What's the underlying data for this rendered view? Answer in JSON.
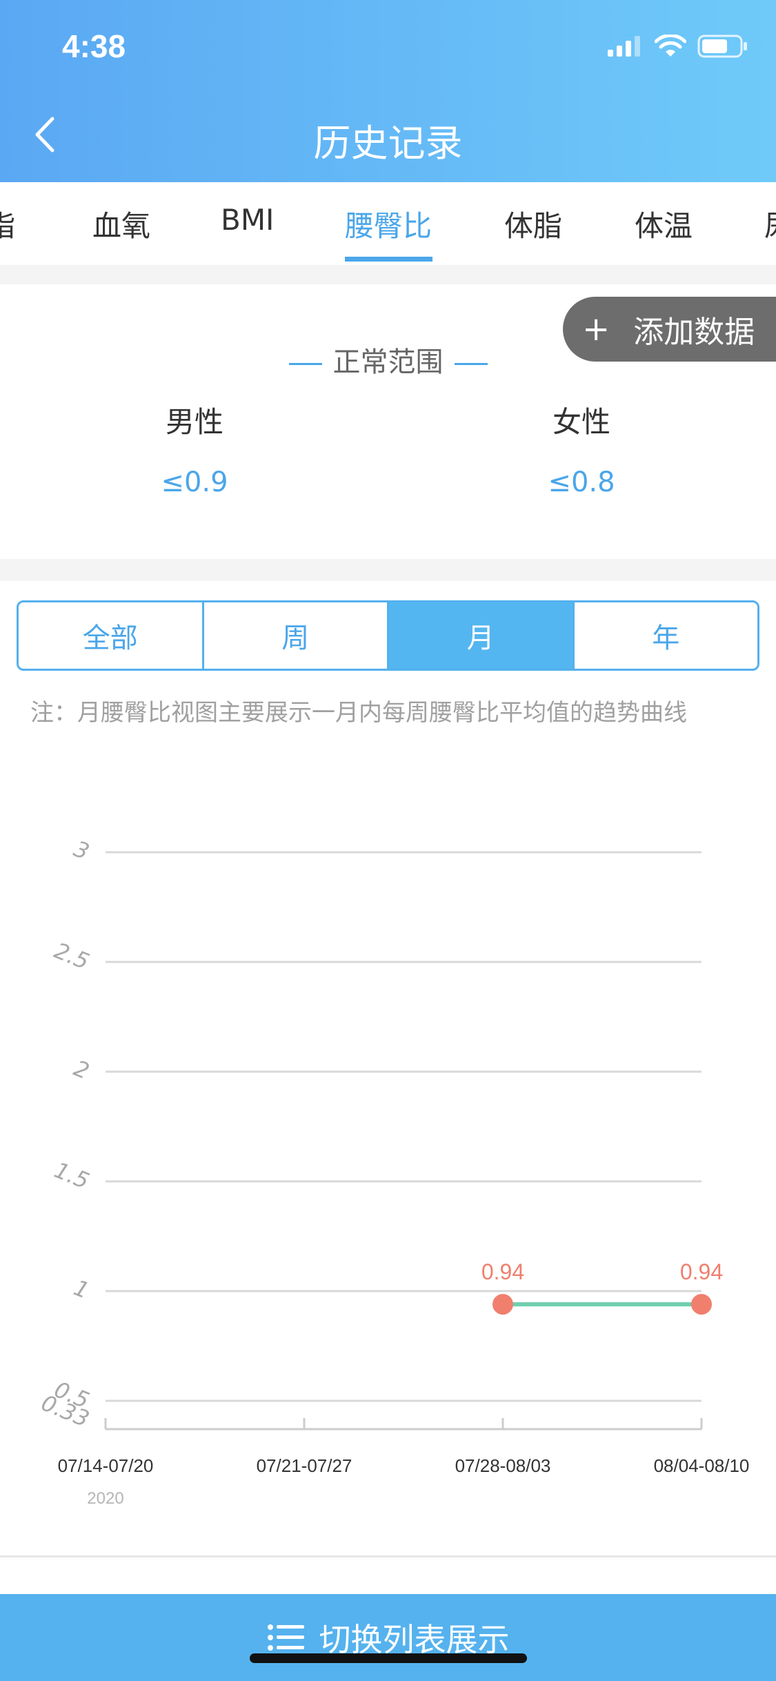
{
  "status_bar": {
    "time": "4:38"
  },
  "header": {
    "title": "历史记录"
  },
  "tabs": [
    "脂",
    "血氧",
    "BMI",
    "腰臀比",
    "体脂",
    "体温",
    "尿"
  ],
  "active_tab": "腰臀比",
  "add_button": {
    "plus": "+",
    "label": "添加数据"
  },
  "normal_range": {
    "title": "正常范围",
    "male": {
      "label": "男性",
      "value": "≤0.9"
    },
    "female": {
      "label": "女性",
      "value": "≤0.8"
    }
  },
  "segments": [
    "全部",
    "周",
    "月",
    "年"
  ],
  "active_segment": "月",
  "note": "注：月腰臀比视图主要展示一月内每周腰臀比平均值的趋势曲线",
  "chart_data": {
    "type": "line",
    "categories": [
      "07/14-07/20",
      "07/21-07/27",
      "07/28-08/03",
      "08/04-08/10"
    ],
    "year_label": "2020",
    "series": [
      {
        "values": [
          null,
          null,
          0.94,
          0.94
        ]
      }
    ],
    "point_labels": [
      "",
      "",
      "0.94",
      "0.94"
    ],
    "y_ticks": [
      "3",
      "2.5",
      "2",
      "1.5",
      "1",
      "0.5",
      "0.33"
    ],
    "ylim": [
      0.33,
      3
    ],
    "grid": true,
    "colors": {
      "line": "#6fcfae",
      "point": "#f07f6e",
      "grid": "#d8d8d8"
    }
  },
  "bottom_button": {
    "label": "切换列表展示"
  }
}
